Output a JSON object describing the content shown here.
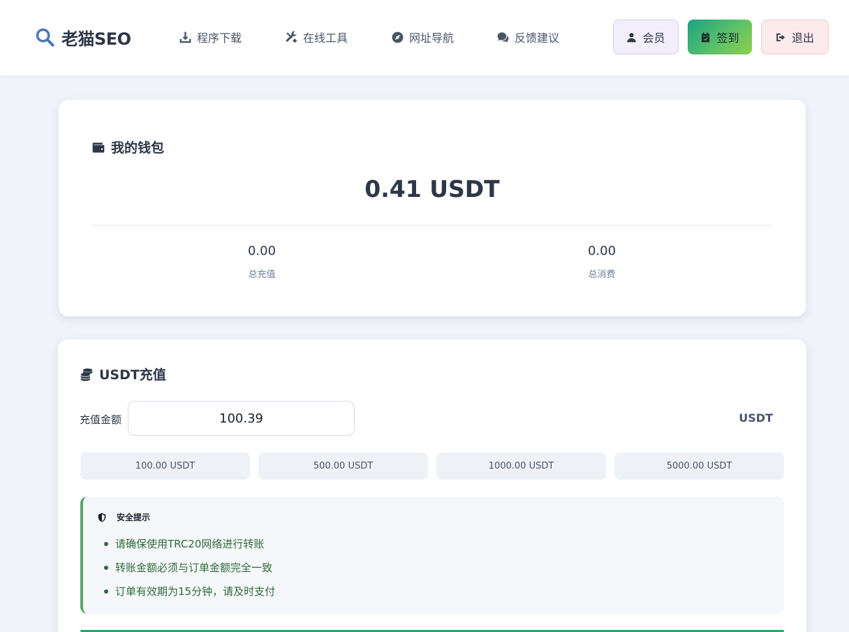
{
  "header": {
    "logo_text": "老猫SEO",
    "nav": [
      {
        "label": "程序下载",
        "icon": "download-icon"
      },
      {
        "label": "在线工具",
        "icon": "tools-icon"
      },
      {
        "label": "网址导航",
        "icon": "compass-icon"
      },
      {
        "label": "反馈建议",
        "icon": "comments-icon"
      }
    ],
    "buttons": {
      "member": {
        "label": "会员",
        "icon": "user-icon"
      },
      "signin": {
        "label": "签到",
        "icon": "calendar-check-icon"
      },
      "logout": {
        "label": "退出",
        "icon": "sign-out-icon"
      }
    }
  },
  "wallet": {
    "title": "我的钱包",
    "icon": "wallet-icon",
    "balance": "0.41 USDT",
    "total_recharge_value": "0.00",
    "total_recharge_label": "总充值",
    "total_spend_value": "0.00",
    "total_spend_label": "总消费"
  },
  "recharge": {
    "title": "USDT充值",
    "icon": "coins-icon",
    "amount_label": "充值金额",
    "amount_value": "100.39",
    "unit": "USDT",
    "presets": [
      "100.00 USDT",
      "500.00 USDT",
      "1000.00 USDT",
      "5000.00 USDT"
    ],
    "notice": {
      "title": "安全提示",
      "icon": "shield-icon",
      "items": [
        "请确保使用TRC20网络进行转账",
        "转账金额必须与订单金额完全一致",
        "订单有效期为15分钟，请及时支付"
      ]
    }
  },
  "colors": {
    "page_bg": "#f1f3f9",
    "logo_icon": "#4a78b8",
    "signin_gradient_start": "#1aa382",
    "signin_gradient_end": "#8ed04d",
    "notice_border": "#5aa469",
    "notice_text": "#2f6b3a"
  }
}
